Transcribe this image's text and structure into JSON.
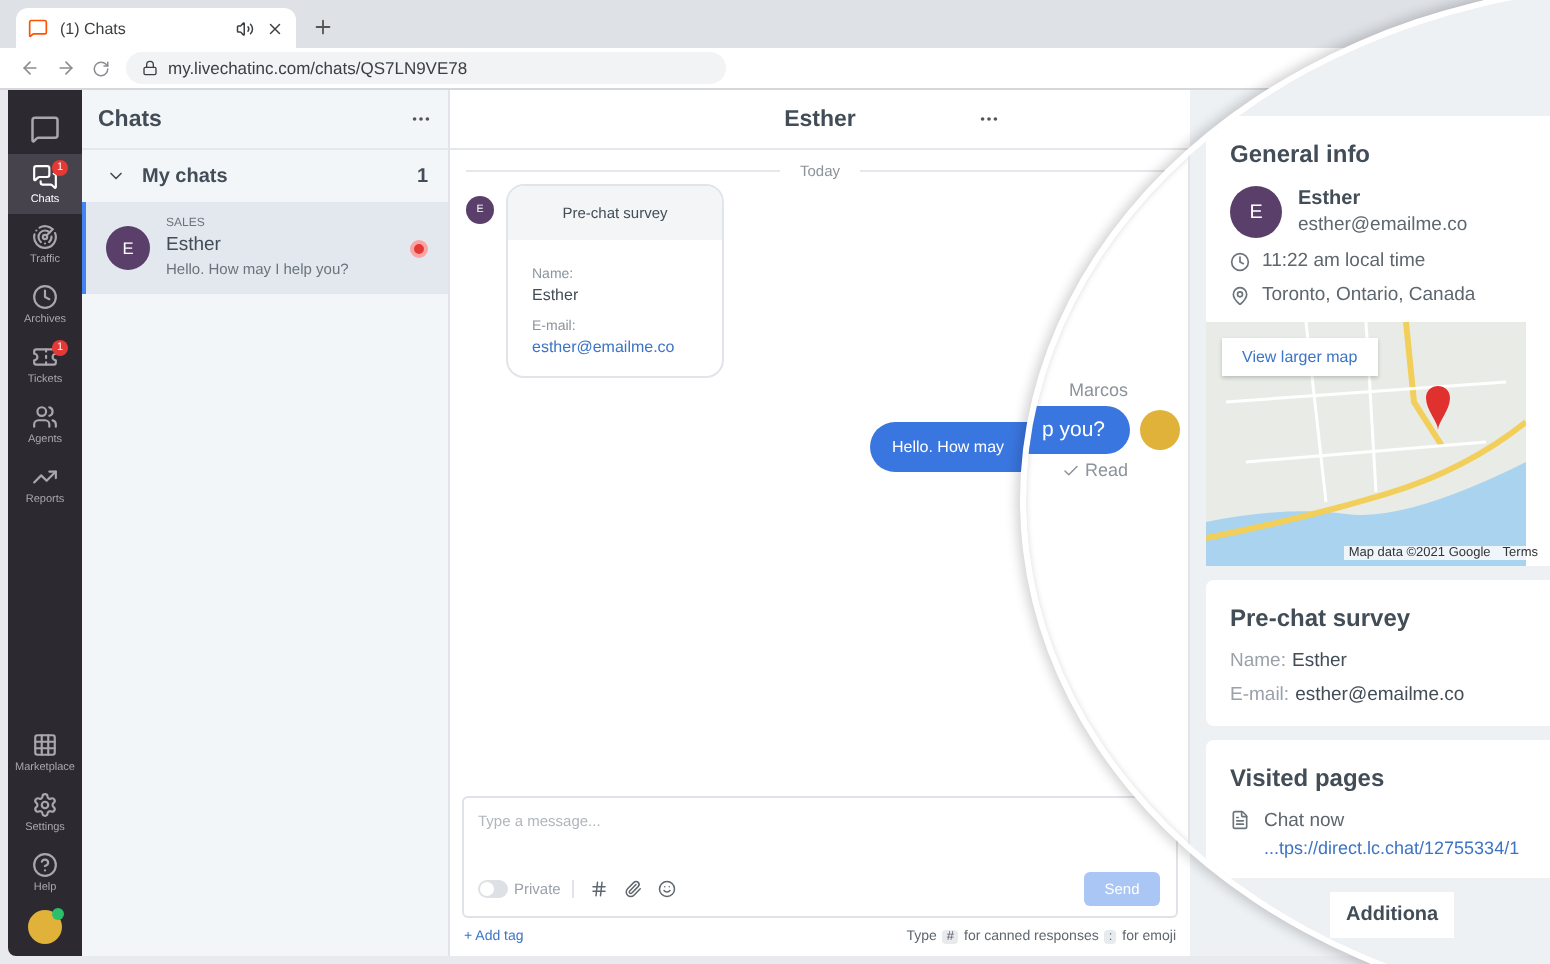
{
  "browser": {
    "tab_title": "(1) Chats",
    "url": "my.livechatinc.com/chats/QS7LN9VE78"
  },
  "nav": {
    "items": [
      {
        "kind": "chats",
        "label": "Chats",
        "selected": true,
        "badge": "1"
      },
      {
        "kind": "traffic",
        "label": "Traffic",
        "selected": false
      },
      {
        "kind": "archives",
        "label": "Archives",
        "selected": false
      },
      {
        "kind": "tickets",
        "label": "Tickets",
        "selected": false,
        "badge": "1"
      },
      {
        "kind": "agents",
        "label": "Agents",
        "selected": false
      },
      {
        "kind": "reports",
        "label": "Reports",
        "selected": false
      }
    ],
    "bottom_items": [
      {
        "kind": "marketplace",
        "label": "Marketplace"
      },
      {
        "kind": "settings",
        "label": "Settings"
      },
      {
        "kind": "help",
        "label": "Help"
      }
    ],
    "agent_online": true
  },
  "chat_list": {
    "title": "Chats",
    "group": {
      "label": "My chats",
      "count": "1",
      "expanded": true
    },
    "chats": [
      {
        "initial": "E",
        "department": "SALES",
        "name": "Esther",
        "preview": "Hello. How may I help you?",
        "selected": true,
        "unread": true
      }
    ]
  },
  "conversation": {
    "title": "Esther",
    "date_divider": "Today",
    "survey": {
      "initial": "E",
      "title": "Pre-chat survey",
      "fields": [
        {
          "kind": "text",
          "label": "Name:",
          "value": "Esther"
        },
        {
          "kind": "link",
          "label": "E-mail:",
          "value": "esther@emailme.co"
        }
      ]
    },
    "agent_reply": "Hello. How may"
  },
  "composer": {
    "placeholder": "Type a message...",
    "private_label": "Private",
    "private_on": false,
    "send_label": "Send",
    "send_disabled": true,
    "add_tag": "+ Add tag",
    "hint": [
      {
        "kind": "text",
        "text": "Type"
      },
      {
        "kind": "key",
        "text": "#"
      },
      {
        "kind": "text",
        "text": "for canned responses"
      },
      {
        "kind": "key",
        "text": ":"
      },
      {
        "kind": "text",
        "text": "for emoji"
      }
    ]
  },
  "magnifier": {
    "agent_name": "Marcos",
    "reply_fragment": "p you?",
    "receipt": "Read",
    "general_info": {
      "title": "General info",
      "initial": "E",
      "name": "Esther",
      "email": "esther@emailme.co",
      "local_time": "11:22 am local time",
      "location": "Toronto, Ontario, Canada",
      "map": {
        "link": "View larger map",
        "attribution": "Map data ©2021 Google",
        "terms": "Terms"
      }
    },
    "pre_chat_survey": {
      "title": "Pre-chat survey",
      "fields": [
        {
          "label": "Name:",
          "value": "Esther"
        },
        {
          "label": "E-mail:",
          "value": "esther@emailme.co"
        }
      ]
    },
    "visited_pages": {
      "title": "Visited pages",
      "pages": [
        {
          "title": "Chat now",
          "url": "...tps://direct.lc.chat/12755334/1"
        }
      ]
    },
    "next_section": "Additiona"
  }
}
